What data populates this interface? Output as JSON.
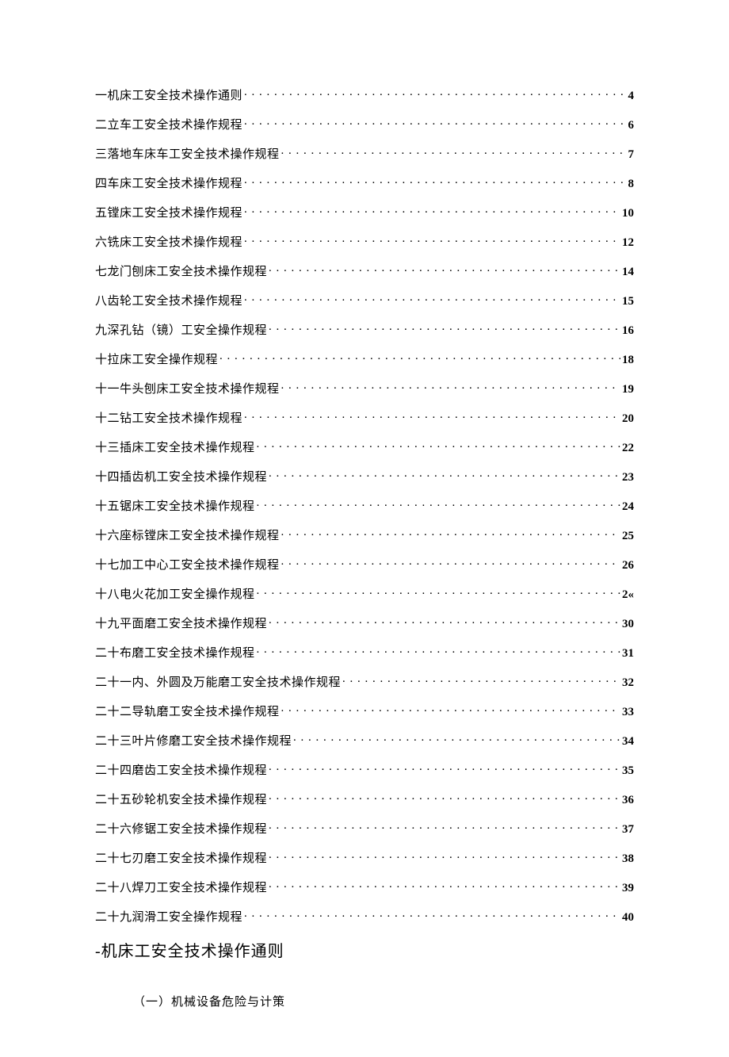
{
  "toc": [
    {
      "title": "一机床工安全技术操作通则",
      "page": "4"
    },
    {
      "title": "二立车工安全技术操作规程",
      "page": "6"
    },
    {
      "title": "三落地车床车工安全技术操作规程",
      "page": "7"
    },
    {
      "title": "四车床工安全技术操作规程",
      "page": "8"
    },
    {
      "title": "五镗床工安全技术操作规程",
      "page": "10"
    },
    {
      "title": "六铣床工安全技术操作规程",
      "page": "12"
    },
    {
      "title": "七龙门刨床工安全技术操作规程",
      "page": "14"
    },
    {
      "title": "八齿轮工安全技术操作规程",
      "page": "15"
    },
    {
      "title": "九深孔钻（镜）工安全操作规程",
      "page": "16"
    },
    {
      "title": "十拉床工安全操作规程",
      "page": "18"
    },
    {
      "title": "十一牛头刨床工安全技术操作规程",
      "page": "19"
    },
    {
      "title": "十二钻工安全技术操作规程",
      "page": "20"
    },
    {
      "title": "十三插床工安全技术操作规程",
      "page": "22"
    },
    {
      "title": "十四插齿机工安全技术操作规程",
      "page": "23"
    },
    {
      "title": "十五锯床工安全技术操作规程",
      "page": "24"
    },
    {
      "title": "十六座标镗床工安全技术操作规程",
      "page": "25"
    },
    {
      "title": "十七加工中心工安全技术操作规程",
      "page": "26"
    },
    {
      "title": "十八电火花加工安全操作规程",
      "page": "2«"
    },
    {
      "title": "十九平面磨工安全技术操作规程",
      "page": "30"
    },
    {
      "title": "二十布磨工安全技术操作规程",
      "page": "31"
    },
    {
      "title": "二十一内、外圆及万能磨工安全技术操作规程",
      "page": "32"
    },
    {
      "title": "二十二导轨磨工安全技术操作规程",
      "page": "33"
    },
    {
      "title": "二十三叶片修磨工安全技术操作规程",
      "page": "34"
    },
    {
      "title": "二十四磨齿工安全技术操作规程",
      "page": "35"
    },
    {
      "title": "二十五砂轮机安全技术操作规程",
      "page": "36"
    },
    {
      "title": "二十六修锯工安全技术操作规程",
      "page": "37"
    },
    {
      "title": "二十七刃磨工安全技术操作规程",
      "page": "38"
    },
    {
      "title": "二十八焊刀工安全技术操作规程",
      "page": "39"
    },
    {
      "title": "二十九润滑工安全操作规程",
      "page": "40"
    }
  ],
  "heading": "-机床工安全技术操作通则",
  "body_line": "（一）机械设备危险与计策"
}
